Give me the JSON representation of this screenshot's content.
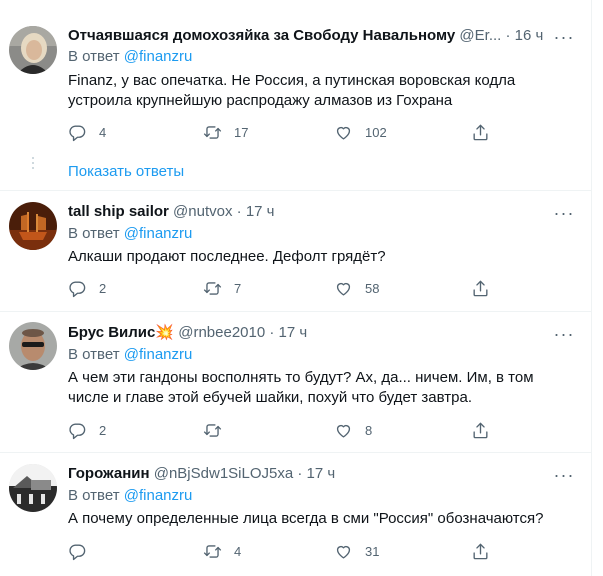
{
  "tweets": [
    {
      "name": "Отчаявшаяся домохозяйка за Свободу Навальному",
      "handle": "@Er...",
      "dot": "·",
      "time": "16 ч",
      "reply_prefix": "В ответ",
      "reply_to": "@finanzru",
      "text": "Finanz, у вас опечатка. Не Россия, а путинская воровская кодла устроила крупнейшую распродажу алмазов из Гохрана",
      "replies": "4",
      "retweets": "17",
      "likes": "102",
      "show_replies": "Показать ответы"
    },
    {
      "name": "tall ship sailor",
      "handle": "@nutvox",
      "dot": "·",
      "time": "17 ч",
      "reply_prefix": "В ответ",
      "reply_to": "@finanzru",
      "text": "Алкаши продают последнее. Дефолт грядёт?",
      "replies": "2",
      "retweets": "7",
      "likes": "58"
    },
    {
      "name": "Брус Вилис",
      "name_emoji": "💥",
      "handle": "@rnbee2010",
      "dot": "·",
      "time": "17 ч",
      "reply_prefix": "В ответ",
      "reply_to": "@finanzru",
      "text": "А чем эти гандоны восполнять то будут? Ах, да... ничем. Им, в том числе и главе этой ебучей шайки, похуй что будет завтра.",
      "replies": "2",
      "retweets": "",
      "likes": "8"
    },
    {
      "name": "Горожанин",
      "handle": "@nBjSdw1SiLOJ5xa",
      "dot": "·",
      "time": "17 ч",
      "reply_prefix": "В ответ",
      "reply_to": "@finanzru",
      "text": "А почему определенные лица всегда в сми \"Россия\" обозначаются?",
      "replies": "",
      "retweets": "4",
      "likes": "31"
    }
  ],
  "icons": {
    "reply": "reply-icon",
    "retweet": "retweet-icon",
    "like": "heart-icon",
    "share": "share-icon",
    "more": "more-icon"
  },
  "colors": {
    "link": "#1d9bf0",
    "secondary_text": "#536471",
    "divider": "#eff3f4"
  }
}
